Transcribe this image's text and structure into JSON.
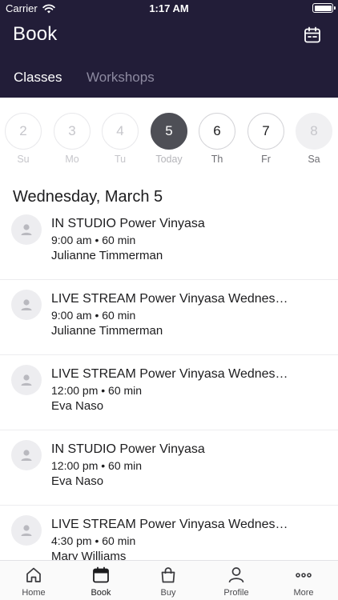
{
  "status_bar": {
    "carrier": "Carrier",
    "time": "1:17 AM"
  },
  "header": {
    "title": "Book",
    "tabs": [
      {
        "label": "Classes",
        "active": true
      },
      {
        "label": "Workshops",
        "active": false
      }
    ]
  },
  "calendar": {
    "days": [
      {
        "num": "2",
        "label": "Su"
      },
      {
        "num": "3",
        "label": "Mo"
      },
      {
        "num": "4",
        "label": "Tu"
      },
      {
        "num": "5",
        "label": "Today"
      },
      {
        "num": "6",
        "label": "Th"
      },
      {
        "num": "7",
        "label": "Fr"
      },
      {
        "num": "8",
        "label": "Sa"
      }
    ]
  },
  "date_heading": "Wednesday, March 5",
  "classes": [
    {
      "name": "IN STUDIO Power Vinyasa",
      "time": "9:00 am • 60 min",
      "teacher": "Julianne Timmerman"
    },
    {
      "name": "LIVE STREAM Power Vinyasa Wednes…",
      "time": "9:00 am • 60 min",
      "teacher": "Julianne Timmerman"
    },
    {
      "name": "LIVE STREAM Power Vinyasa Wednes…",
      "time": "12:00 pm • 60 min",
      "teacher": "Eva Naso"
    },
    {
      "name": "IN STUDIO Power Vinyasa",
      "time": "12:00 pm • 60 min",
      "teacher": "Eva Naso"
    },
    {
      "name": "LIVE STREAM Power Vinyasa Wednes…",
      "time": "4:30 pm • 60 min",
      "teacher": "Mary Williams"
    }
  ],
  "tab_bar": [
    {
      "label": "Home",
      "icon": "home-icon"
    },
    {
      "label": "Book",
      "icon": "calendar-icon",
      "active": true
    },
    {
      "label": "Buy",
      "icon": "bag-icon"
    },
    {
      "label": "Profile",
      "icon": "person-icon"
    },
    {
      "label": "More",
      "icon": "more-icon"
    }
  ],
  "colors": {
    "header_bg": "#221d38",
    "today_circle": "#4e4f56"
  }
}
